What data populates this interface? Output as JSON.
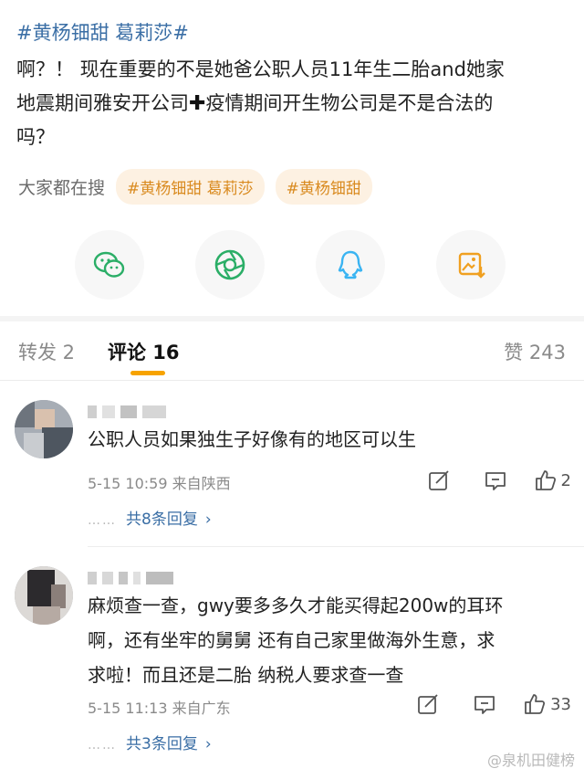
{
  "post": {
    "tags": "#黄杨钿甜 葛莉莎#",
    "line1": "啊？！ 现在重要的不是她爸公职人员11年生二胎and她家",
    "line2a": "地震期间雅安开公司",
    "line2b": "疫情期间开生物公司是不是合法的",
    "line3": "吗？"
  },
  "hot_search": {
    "label": "大家都在搜",
    "chips": [
      "#黄杨钿甜 葛莉莎",
      "#黄杨钿甜"
    ]
  },
  "share": {
    "icons": [
      "wechat-icon",
      "moments-icon",
      "qq-icon",
      "save-image-icon"
    ]
  },
  "tabs": {
    "repost": "转发 2",
    "comments": "评论 16",
    "likes": "赞 243"
  },
  "comments": [
    {
      "text": "公职人员如果独生子好像有的地区可以生",
      "meta": "5-15 10:59 来自陕西",
      "likes": "2",
      "replies": "共8条回复"
    },
    {
      "text_lines": [
        "麻烦查一查，gwy要多多久才能买得起200w的耳环",
        "啊，还有坐牢的舅舅 还有自己家里做海外生意，求",
        "求啦！而且还是二胎 纳税人要求查一查"
      ],
      "meta": "5-15 11:13 来自广东",
      "likes": "33",
      "replies": "共3条回复"
    }
  ],
  "colors": {
    "link": "#3a6ea5",
    "accent": "#f7a300",
    "chip_bg": "#fdf1e2",
    "chip_text": "#d98a1f"
  },
  "watermark": "@泉机田健榜"
}
